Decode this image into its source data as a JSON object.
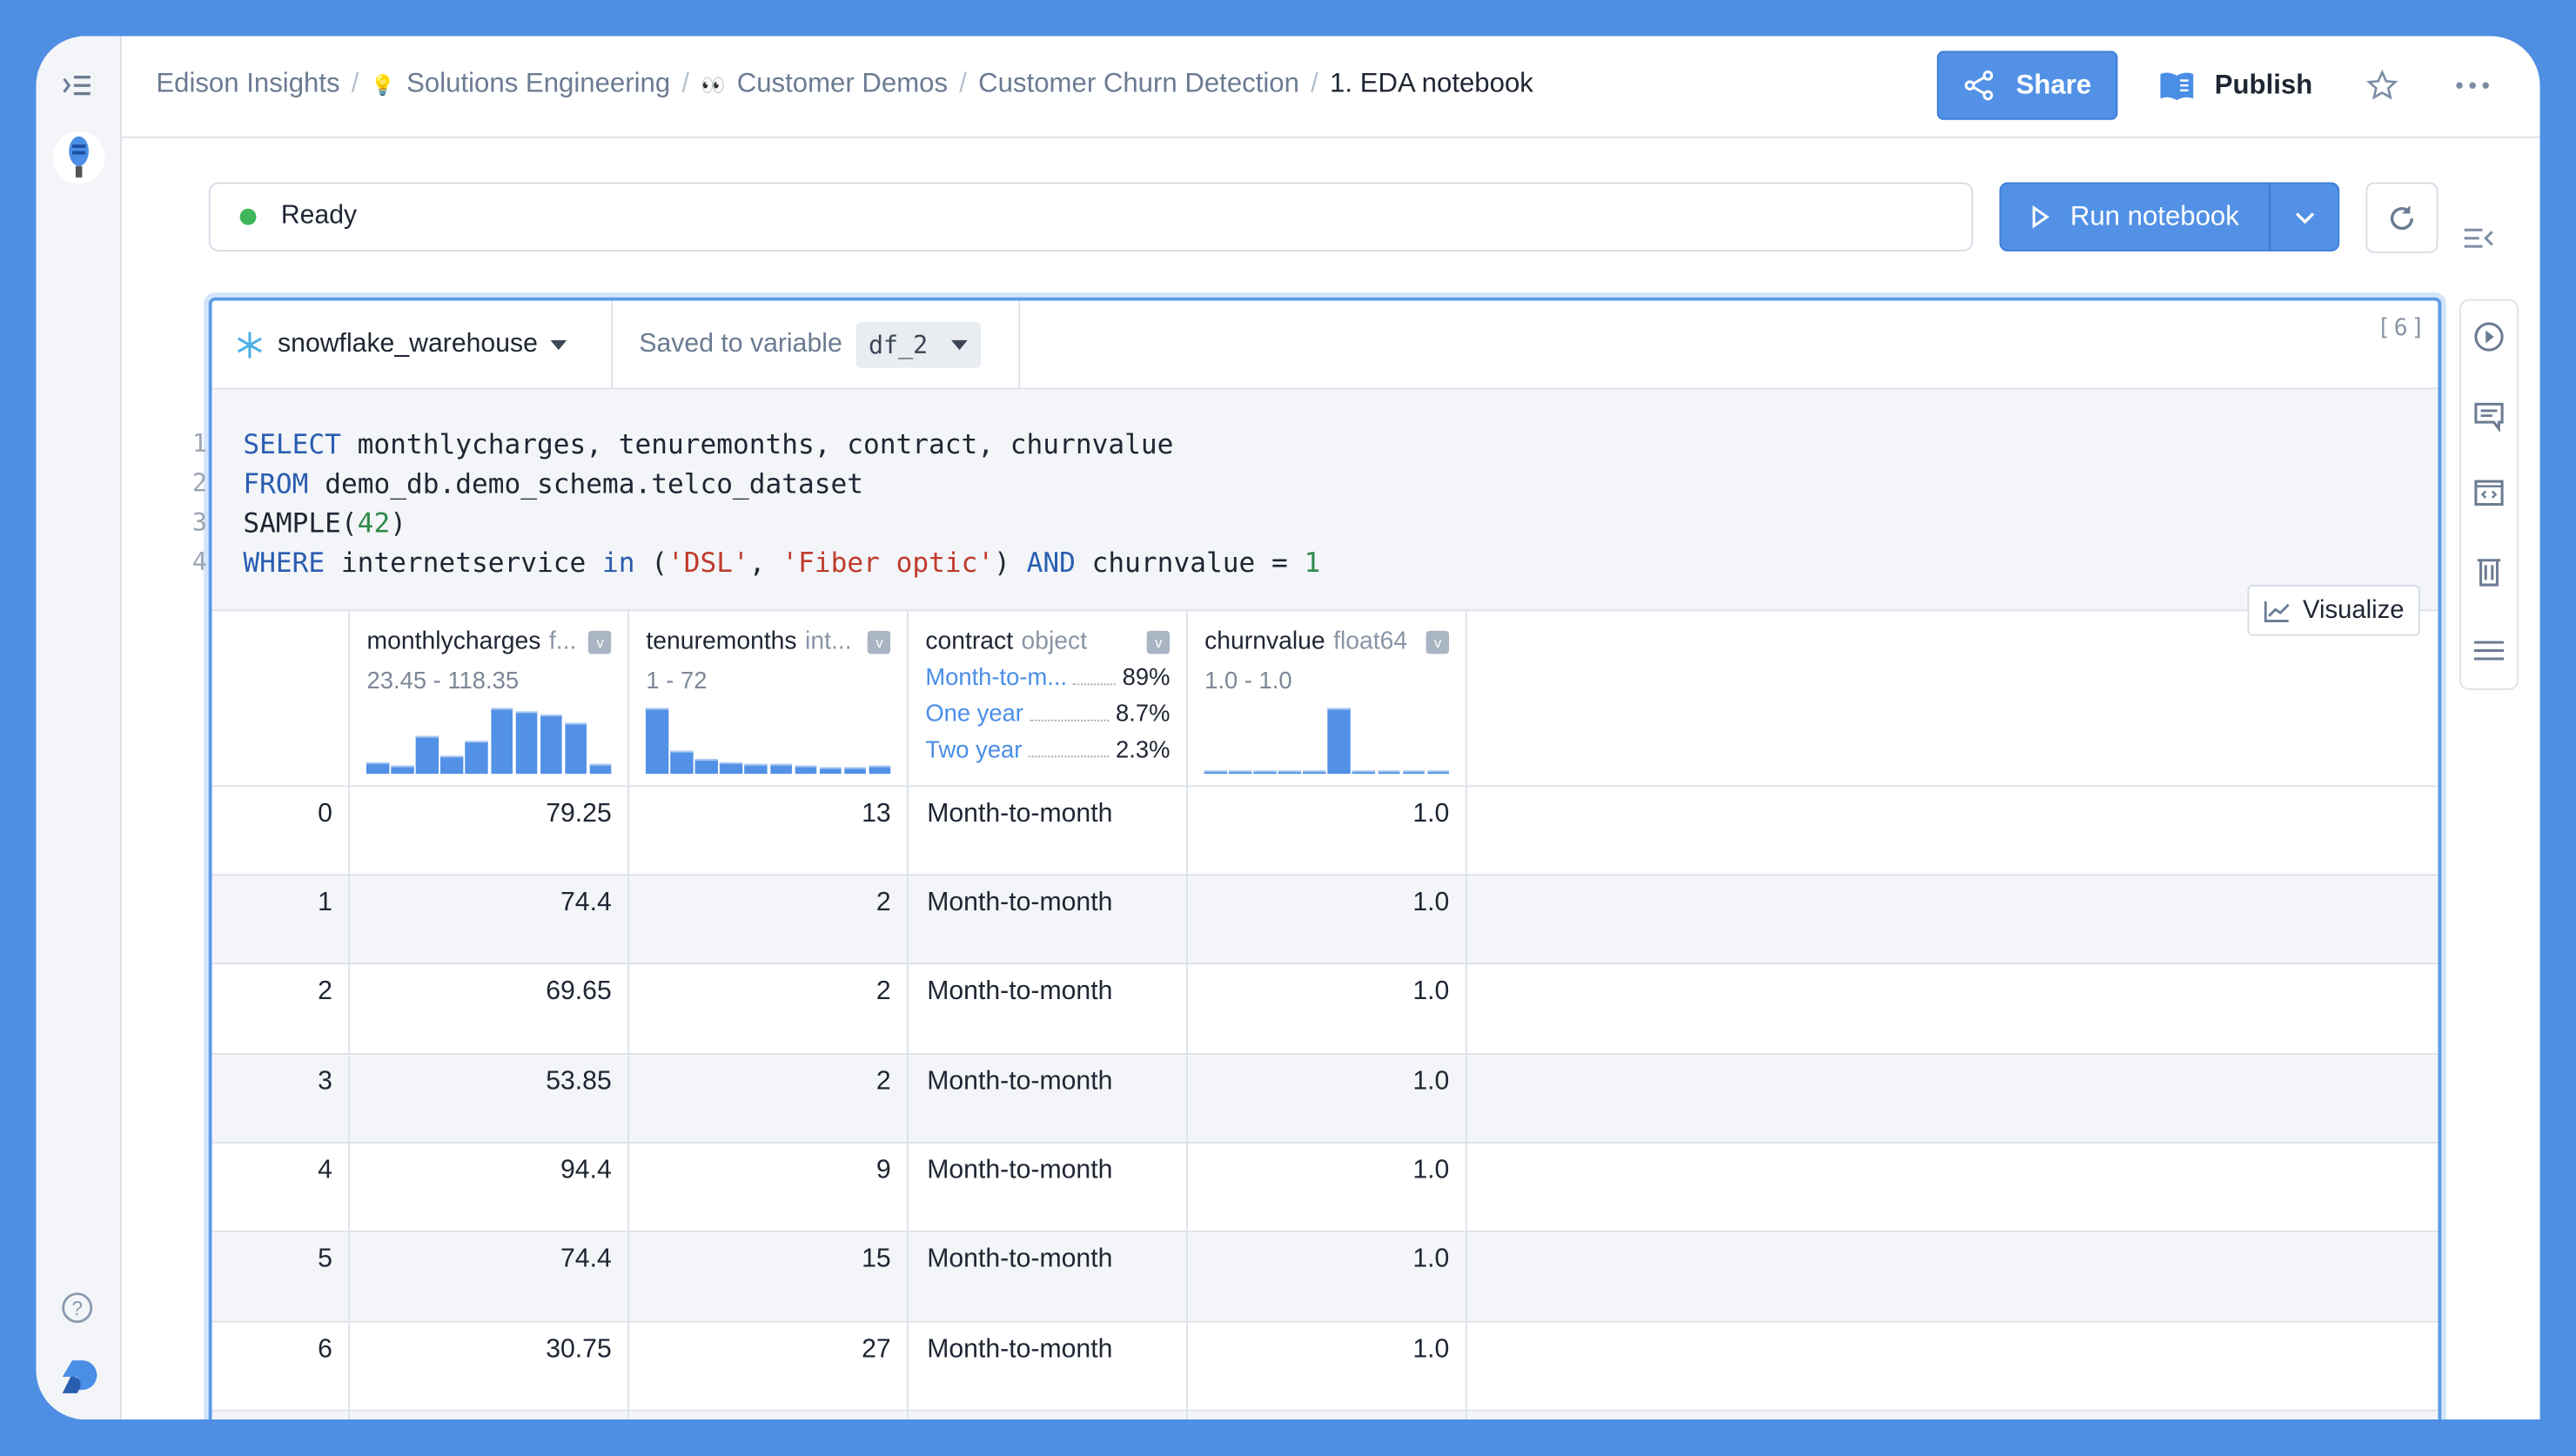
{
  "breadcrumb": {
    "items": [
      "Edison Insights",
      "Solutions Engineering",
      "Customer Demos",
      "Customer Churn Detection"
    ],
    "current": "1. EDA notebook",
    "sep": "/",
    "emoji1": "💡",
    "emoji2": "👀"
  },
  "header": {
    "share_label": "Share",
    "publish_label": "Publish"
  },
  "status": {
    "text": "Ready",
    "color": "#3fb65a"
  },
  "run": {
    "label": "Run notebook"
  },
  "cell": {
    "datasource": "snowflake_warehouse",
    "saved_label": "Saved to variable",
    "variable": "df_2",
    "exec_count": "[6]",
    "visualize_label": "Visualize",
    "line_numbers": [
      "1",
      "2",
      "3",
      "4"
    ]
  },
  "table": {
    "columns": [
      {
        "name": "monthlycharges",
        "type": "f...",
        "range": "23.45 - 118.35",
        "hist": [
          0.17,
          0.13,
          0.57,
          0.27,
          0.5,
          1,
          0.95,
          0.9,
          0.77,
          0.15
        ]
      },
      {
        "name": "tenuremonths",
        "type": "int...",
        "range": "1 - 72",
        "hist": [
          1,
          0.34,
          0.23,
          0.18,
          0.16,
          0.16,
          0.12,
          0.11,
          0.09,
          0.13
        ]
      },
      {
        "name": "contract",
        "type": "object",
        "cats": [
          {
            "name": "Month-to-m...",
            "pct": "89%"
          },
          {
            "name": "One year",
            "pct": "8.7%"
          },
          {
            "name": "Two year",
            "pct": "2.3%"
          }
        ]
      },
      {
        "name": "churnvalue",
        "type": "float64",
        "range": "1.0 - 1.0",
        "hist": [
          0.02,
          0.02,
          0.02,
          0.02,
          0.02,
          1,
          0.02,
          0.02,
          0.02,
          0.02
        ]
      }
    ],
    "rows": [
      [
        "0",
        "79.25",
        "13",
        "Month-to-month",
        "1.0"
      ],
      [
        "1",
        "74.4",
        "2",
        "Month-to-month",
        "1.0"
      ],
      [
        "2",
        "69.65",
        "2",
        "Month-to-month",
        "1.0"
      ],
      [
        "3",
        "53.85",
        "2",
        "Month-to-month",
        "1.0"
      ],
      [
        "4",
        "94.4",
        "9",
        "Month-to-month",
        "1.0"
      ],
      [
        "5",
        "74.4",
        "15",
        "Month-to-month",
        "1.0"
      ],
      [
        "6",
        "30.75",
        "27",
        "Month-to-month",
        "1.0"
      ],
      [
        "",
        "",
        "",
        "",
        ""
      ]
    ]
  },
  "code": {
    "l1": [
      "SELECT",
      " monthlycharges, tenuremonths, contract, churnvalue"
    ],
    "l2": [
      "FROM",
      " demo_db.demo_schema.telco_dataset"
    ],
    "l3": [
      "SAMPLE(",
      "42",
      ")"
    ],
    "l4": [
      "WHERE",
      " internetservice ",
      "in",
      " (",
      "'DSL'",
      ", ",
      "'Fiber optic'",
      ") ",
      "AND",
      " churnvalue = ",
      "1"
    ]
  },
  "colors": {
    "accent": "#5291e6",
    "background": "#4f8fe3"
  }
}
